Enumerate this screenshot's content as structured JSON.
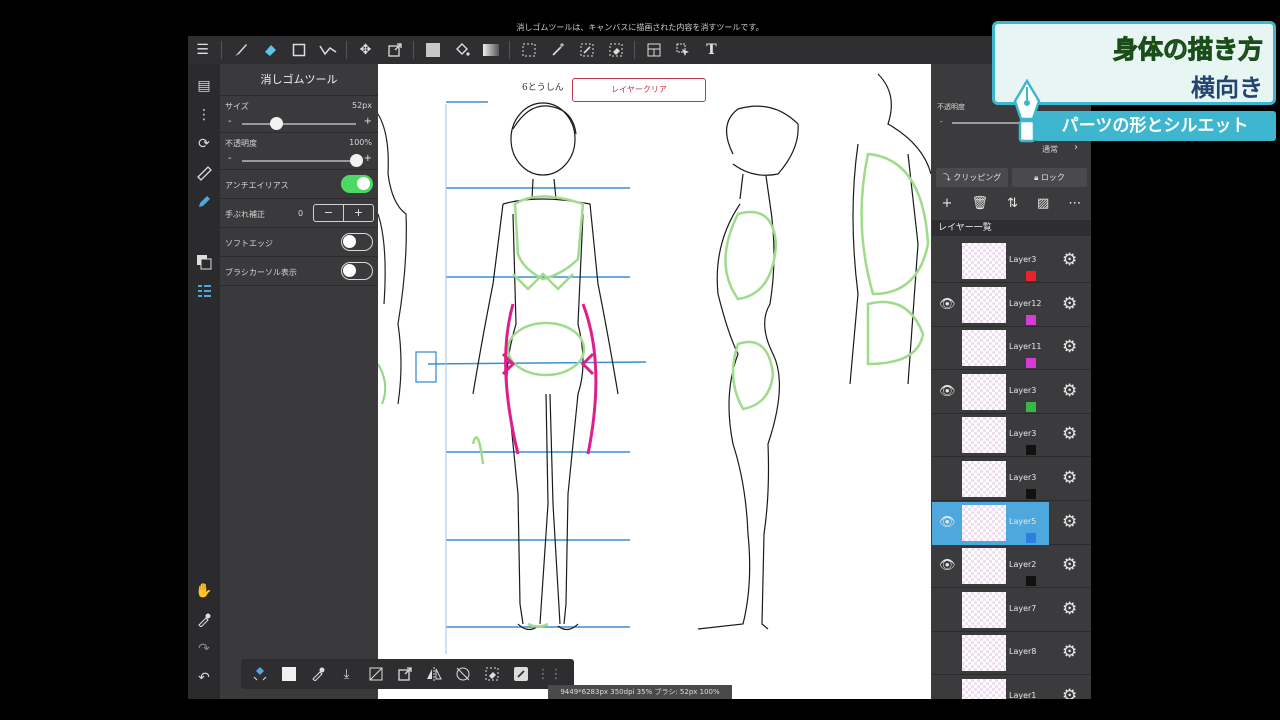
{
  "top_tip": "消しゴムツールは、キャンバスに描画された内容を消すツールです。",
  "tool_panel": {
    "title": "消しゴムツール",
    "size": {
      "label": "サイズ",
      "value": "52px",
      "level": 0.3
    },
    "opacity": {
      "label": "不透明度",
      "value": "100%",
      "level": 1.0
    },
    "antialias": {
      "label": "アンチエイリアス",
      "on": true
    },
    "stabilizer": {
      "label": "手ぶれ補正",
      "value": "0"
    },
    "soft_edge": {
      "label": "ソフトエッジ",
      "on": false
    },
    "brush_cursor": {
      "label": "ブラシカーソル表示",
      "on": false
    },
    "minus": "-",
    "plus": "+"
  },
  "canvas": {
    "layer_clear_button": "レイヤークリア",
    "note": "6とうしん"
  },
  "status_bar": "9449*6283px 350dpi 35% ブラシ: 52px 100%",
  "layer_panel": {
    "opacity_label": "不透明度",
    "blend_mode": "通常",
    "clipping": "クリッピング",
    "lock": "ロック",
    "list_header": "レイヤー一覧",
    "layers": [
      {
        "name": "Layer3",
        "visible": false,
        "selected": false,
        "tag": "#e8242a"
      },
      {
        "name": "Layer12",
        "visible": true,
        "selected": false,
        "tag": "#d63bd6"
      },
      {
        "name": "Layer11",
        "visible": false,
        "selected": false,
        "tag": "#d63bd6"
      },
      {
        "name": "Layer3",
        "visible": true,
        "selected": false,
        "tag": "#3bb54a"
      },
      {
        "name": "Layer3",
        "visible": false,
        "selected": false,
        "tag": "#111111"
      },
      {
        "name": "Layer3",
        "visible": false,
        "selected": false,
        "tag": "#111111"
      },
      {
        "name": "Layer5",
        "visible": true,
        "selected": true,
        "tag": "#2a7fe0"
      },
      {
        "name": "Layer2",
        "visible": true,
        "selected": false,
        "tag": "#111111"
      },
      {
        "name": "Layer7",
        "visible": false,
        "selected": false,
        "tag": ""
      },
      {
        "name": "Layer8",
        "visible": false,
        "selected": false,
        "tag": ""
      },
      {
        "name": "Layer1",
        "visible": false,
        "selected": false,
        "tag": ""
      }
    ]
  },
  "overlay": {
    "title1": "身体の描き方",
    "title2": "横向き",
    "subtitle": "パーツの形とシルエット"
  },
  "colors": {
    "accent": "#3fb6cf",
    "toggle_on": "#4cd964",
    "selected_layer": "#4ea8de",
    "clear_button": "#c2344a"
  }
}
